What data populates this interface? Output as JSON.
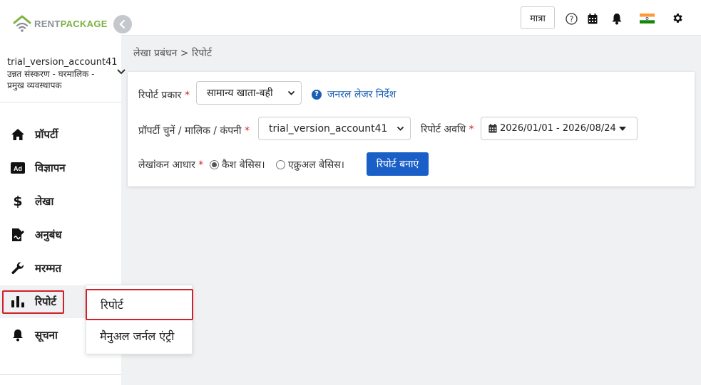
{
  "brand": {
    "part1": "RENT",
    "part2": "PACKAGE",
    "accent": "#7cb342"
  },
  "account": {
    "name": "trial_version_account41",
    "role": "उन्नत संस्करण - घरमालिक - प्रमुख व्यवस्थापक"
  },
  "sidebar": {
    "items": [
      {
        "label": "प्रॉपर्टी",
        "icon": "home-icon"
      },
      {
        "label": "विज्ञापन",
        "icon": "ad-icon"
      },
      {
        "label": "लेखा",
        "icon": "dollar-icon"
      },
      {
        "label": "अनुबंध",
        "icon": "contract-icon"
      },
      {
        "label": "मरम्मत",
        "icon": "wrench-icon"
      },
      {
        "label": "रिपोर्ट",
        "icon": "bar-chart-icon"
      },
      {
        "label": "सूचना",
        "icon": "bell-icon"
      }
    ]
  },
  "submenu": {
    "items": [
      {
        "label": "रिपोर्ट"
      },
      {
        "label": "मैनुअल जर्नल एंट्री"
      }
    ]
  },
  "topbar": {
    "qty_label": "मात्रा"
  },
  "breadcrumb": "लेखा प्रबंधन > रिपोर्ट",
  "form": {
    "report_type_label": "रिपोर्ट प्रकार",
    "report_type_value": "सामान्य खाता-बही",
    "help_link": "जनरल लेजर निर्देश",
    "property_label": "प्रॉपर्टी चुनें / मालिक / कंपनी",
    "property_value": "trial_version_account41",
    "period_label": "रिपोर्ट अवधि",
    "period_value": "2026/01/01 - 2026/08/24",
    "basis_label": "लेखांकन आधार",
    "basis_cash": "कैश बेसिस।",
    "basis_accrual": "एक्रुअल बेसिस।",
    "generate_button": "रिपोर्ट बनाएं",
    "required_mark": "*"
  },
  "colors": {
    "primary": "#1a5fc8",
    "danger": "#d0202a"
  }
}
